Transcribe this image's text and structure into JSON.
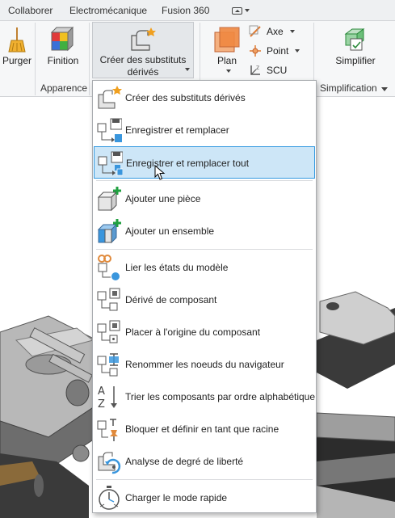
{
  "tabs": [
    "Collaborer",
    "Electromécanique",
    "Fusion 360"
  ],
  "ribbon": {
    "purger": "Purger",
    "finition": "Finition",
    "creer_line1": "Créer des substituts",
    "creer_line2": "dérivés",
    "plan": "Plan",
    "axe": "Axe",
    "point": "Point",
    "scu": "SCU",
    "simplifier": "Simplifier",
    "panel_apparence": "Apparence",
    "panel_simplification": "Simplification"
  },
  "menu": {
    "items": [
      "Créer des substituts dérivés",
      "Enregistrer et remplacer",
      "Enregistrer et remplacer tout",
      "Ajouter une pièce",
      "Ajouter un ensemble",
      "Lier les états du modèle",
      "Dérivé de composant",
      "Placer à l'origine du composant",
      "Renommer les noeuds du navigateur",
      "Trier les composants par ordre alphabétique",
      "Bloquer et définir en tant que racine",
      "Analyse de degré de liberté",
      "Charger le mode rapide"
    ]
  },
  "colors": {
    "highlight_bg": "#cde6f7",
    "highlight_border": "#3399e0",
    "accent_blue": "#3a96dd",
    "accent_green": "#20a040",
    "accent_orange": "#e08a3c"
  }
}
